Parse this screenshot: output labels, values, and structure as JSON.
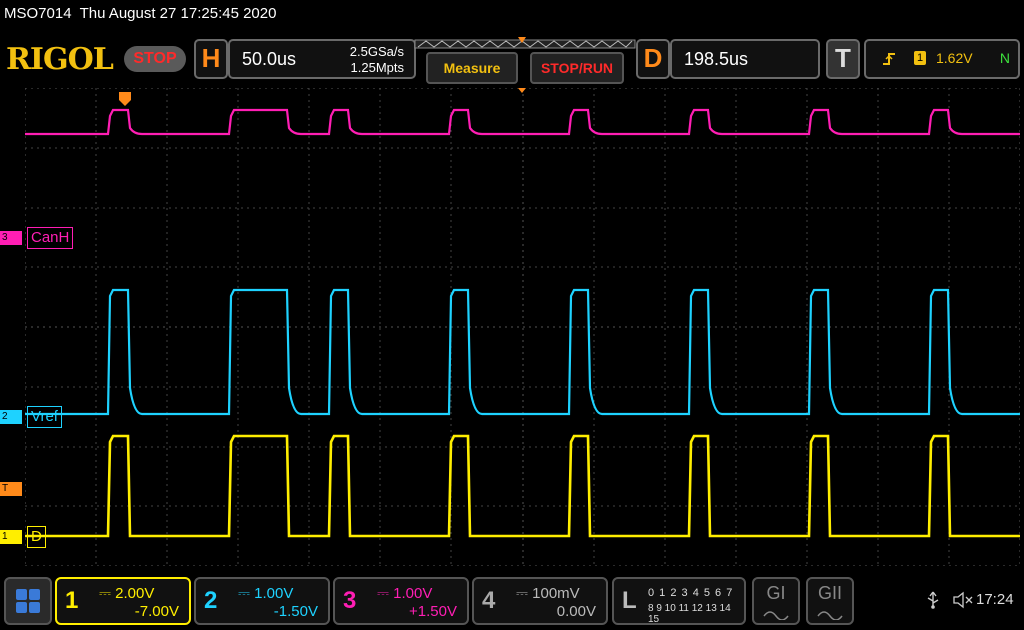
{
  "header": {
    "model": "MSO7014",
    "datetime": "Thu August 27 17:25:45 2020"
  },
  "toolbar": {
    "brand": "RIGOL",
    "run_state": "STOP",
    "horizontal_letter": "H",
    "timebase": "50.0us",
    "sample_rate": "2.5GSa/s",
    "memory_depth": "1.25Mpts",
    "measure_label": "Measure",
    "stoprun_label": "STOP/RUN",
    "delay_letter": "D",
    "delay": "198.5us",
    "trigger_letter": "T",
    "trigger_source": "1",
    "trigger_level": "1.62V",
    "trigger_mode": "N"
  },
  "channels": [
    {
      "id": "3",
      "label": "CanH",
      "color": "#ff1eb4"
    },
    {
      "id": "2",
      "label": "Vref",
      "color": "#1ed2ff"
    },
    {
      "id": "1",
      "label": "D",
      "color": "#ffee00"
    }
  ],
  "trigger_marker": "T",
  "bottom": {
    "ch1": {
      "num": "1",
      "scale": "2.00V",
      "offset": "-7.00V"
    },
    "ch2": {
      "num": "2",
      "scale": "1.00V",
      "offset": "-1.50V"
    },
    "ch3": {
      "num": "3",
      "scale": "1.00V",
      "offset": "+1.50V"
    },
    "ch4": {
      "num": "4",
      "scale": "100mV",
      "offset": "0.00V"
    },
    "la": {
      "letter": "L",
      "row1": "0 1 2 3  4 5 6 7",
      "row2": "8 9 10 11 12 13 14 15"
    },
    "g1": "GI",
    "g2": "GII",
    "clock": "17:24"
  },
  "colors": {
    "ch1": "#ffee00",
    "ch2": "#1ed2ff",
    "ch3": "#ff1eb4",
    "ch4": "#aaaaaa",
    "accent": "#ff8a1a"
  }
}
